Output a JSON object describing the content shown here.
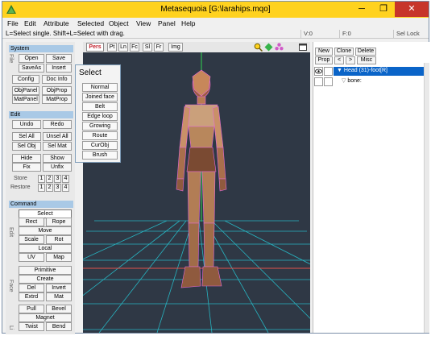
{
  "window": {
    "title": "Metasequoia [G:\\larahips.mqo]",
    "minimize": "─",
    "restore": "❐",
    "close": "✕"
  },
  "menu": [
    "File",
    "Edit",
    "Attribute",
    "Selected",
    "Object",
    "View",
    "Panel",
    "Help"
  ],
  "status": {
    "hint": "L=Select single.  Shift+L=Select with drag.",
    "v": "V:0",
    "f": "F:0",
    "sel_lock": "Sel Lock"
  },
  "left_panel": {
    "system": {
      "header": "System",
      "side_label": "File",
      "buttons": [
        "Open",
        "Save",
        "SaveAs",
        "Insert",
        "Config",
        "Doc Info",
        "ObjPanel",
        "ObjProp",
        "MatPanel",
        "MatProp"
      ]
    },
    "edit": {
      "header": "Edit",
      "buttons": [
        "Undo",
        "Redo",
        "Sel All",
        "Unsel All",
        "Sel Obj",
        "Sel Mat",
        "Hide",
        "Show",
        "Fix",
        "Unfix"
      ],
      "store_label": "Store",
      "restore_label": "Restore",
      "nums": [
        "1",
        "2",
        "3",
        "4"
      ]
    },
    "command": {
      "header": "Command",
      "side_edit": "Edit",
      "side_face": "Face",
      "side_more": "Li",
      "buttons": [
        "Select",
        "Rect",
        "Rope",
        "Move",
        "Scale",
        "Rot",
        "Local",
        "UV",
        "Map",
        "Primitive",
        "Create",
        "Del",
        "Invert",
        "Extrd",
        "Mat",
        "Pull",
        "Bevel",
        "Magnet",
        "Twist",
        "Bend"
      ]
    }
  },
  "viewport": {
    "tabs": [
      "Pers",
      "Pt",
      "Ln",
      "Fc",
      "Sl",
      "Fr",
      "Img"
    ],
    "active_tab": "Pers",
    "icons": [
      "magnify-icon",
      "pan-icon",
      "rotate-icon",
      "maximize-icon"
    ]
  },
  "select_popup": {
    "title": "Select",
    "options": [
      "Normal",
      "Joined face",
      "Belt",
      "Edge loop",
      "Growing",
      "Route",
      "CurObj",
      "Brush"
    ]
  },
  "right_panel": {
    "buttons": [
      "New",
      "Clone",
      "Delete",
      "Prop",
      "<",
      ">",
      "Misc"
    ],
    "objects": [
      {
        "name": "Head (31)-foot[R]",
        "selected": true
      },
      {
        "name": "bone:",
        "selected": false
      }
    ]
  },
  "colors": {
    "title_bar": "#ffd21f",
    "close": "#c7352a",
    "viewport_bg": "#2f3845",
    "grid": "#27c2cf",
    "wire": "#e46ad8",
    "selected_row": "#0a64c8",
    "section_header": "#a9c9e6"
  }
}
